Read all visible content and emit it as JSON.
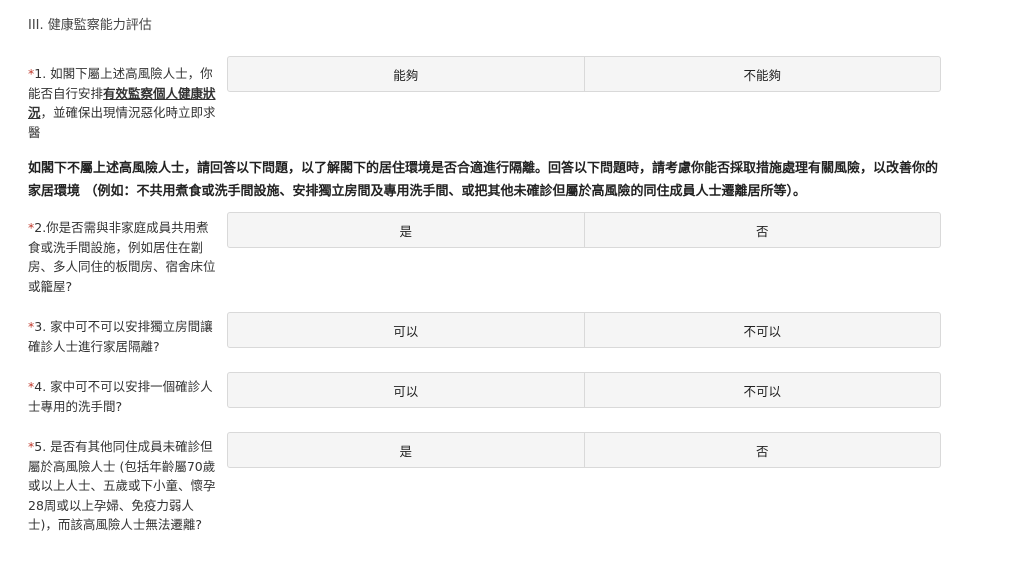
{
  "section_title": "III. 健康監察能力評估",
  "q1": {
    "star": "*",
    "pre": "1. 如閣下屬上述高風險人士，你能否自行安排",
    "em": "有效監察個人健康狀況",
    "post": "，並確保出現情況惡化時立即求醫",
    "options": [
      "能夠",
      "不能夠"
    ]
  },
  "instruction": "如閣下不屬上述高風險人士，請回答以下問題，以了解閣下的居住環境是否合適進行隔離。回答以下問題時，請考慮你能否採取措施處理有關風險，以改善你的家居環境 （例如：不共用煮食或洗手間設施、安排獨立房間及專用洗手間、或把其他未確診但屬於高風險的同住成員人士遷離居所等）。",
  "q2": {
    "star": "*",
    "text": "2.你是否需與非家庭成員共用煮食或洗手間設施，例如居住在劏房、多人同住的板間房、宿舍床位或籠屋?",
    "options": [
      "是",
      "否"
    ]
  },
  "q3": {
    "star": "*",
    "text": "3. 家中可不可以安排獨立房間讓確診人士進行家居隔離?",
    "options": [
      "可以",
      "不可以"
    ]
  },
  "q4": {
    "star": "*",
    "text": "4. 家中可不可以安排一個確診人士專用的洗手間?",
    "options": [
      "可以",
      "不可以"
    ]
  },
  "q5": {
    "star": "*",
    "text": "5. 是否有其他同住成員未確診但屬於高風險人士 (包括年齡屬70歲或以上人士、五歲或下小童、懷孕28周或以上孕婦、免疫力弱人士)，而該高風險人士無法遷離?",
    "options": [
      "是",
      "否"
    ]
  }
}
